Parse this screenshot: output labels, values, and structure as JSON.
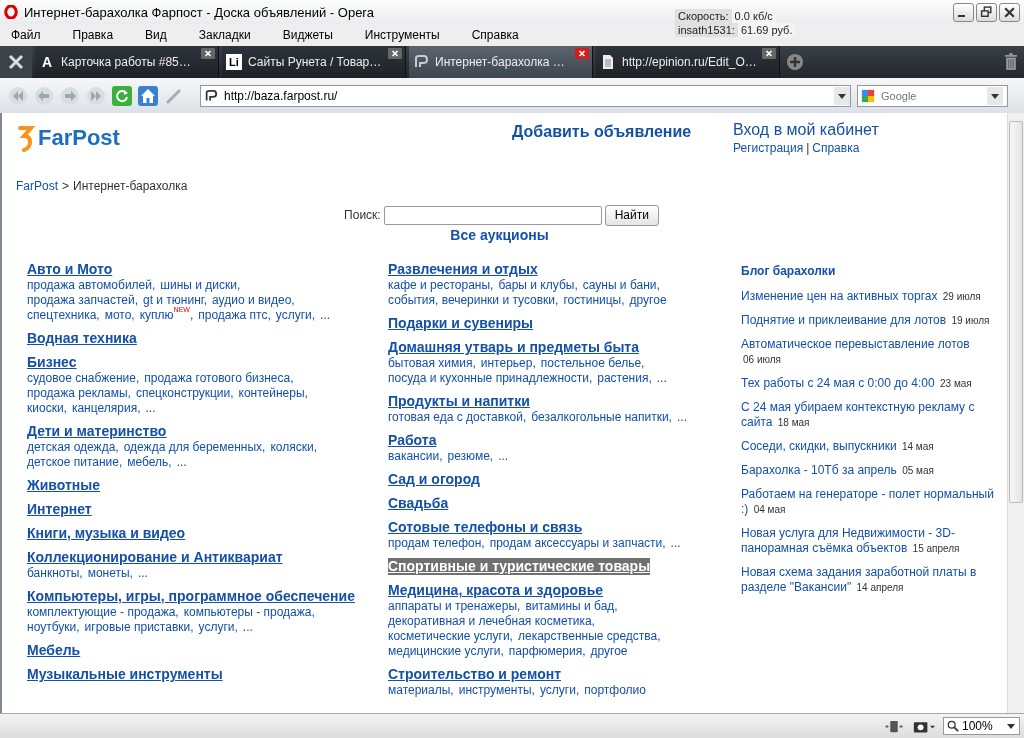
{
  "window": {
    "title": "Интернет-барахолка Фарпост - Доска объявлений - Opera"
  },
  "traffic": [
    {
      "label": "Скорость:",
      "value": "0.0 кб/с"
    },
    {
      "label": "insath1531:",
      "value": "61.69 руб."
    }
  ],
  "menu": [
    "Файл",
    "Правка",
    "Вид",
    "Закладки",
    "Виджеты",
    "Инструменты",
    "Справка"
  ],
  "tabs": [
    {
      "kind": "letter",
      "icon_text": "A",
      "label": "Карточка работы #85…",
      "selected": false
    },
    {
      "kind": "badge",
      "icon_text": "Li",
      "label": "Сайты Рунета / Товар…",
      "selected": false
    },
    {
      "kind": "site",
      "label": "Интернет-барахолка …",
      "selected": true
    },
    {
      "kind": "page",
      "label": "http://epinion.ru/Edit_O…",
      "selected": false
    }
  ],
  "address": {
    "value": "http://baza.farpost.ru/"
  },
  "search": {
    "placeholder": "Google"
  },
  "page": {
    "logo": "FarPost",
    "add_ad": "Добавить объявление",
    "login": "Вход в мой кабинет",
    "register": "Регистрация",
    "help": "Справка",
    "separator": "|",
    "breadcrumb_link": "FarPost",
    "breadcrumb_separator": ">",
    "breadcrumb_current": "Интернет-барахолка",
    "search_label": "Поиск:",
    "search_button": "Найти",
    "all_auctions": "Все аукционы"
  },
  "columns": [
    [
      {
        "title": "Авто и Мото",
        "highlighted": false,
        "subs": [
          "продажа автомобилей,",
          "шины и диски,",
          "продажа запчастей,",
          "gt и тюнинг,",
          "аудио и видео,",
          "спецтехника,",
          "мото,",
          "куплю$^{NEW}$,",
          "продажа птс,",
          "услуги,",
          "..."
        ]
      },
      {
        "title": "Водная техника",
        "highlighted": false
      },
      {
        "title": "Бизнес",
        "highlighted": false,
        "subs": [
          "судовое снабжение,",
          "продажа готового бизнеса,",
          "продажа рекламы,",
          "спецконструкции,",
          "контейнеры,",
          "киоски,",
          "канцелярия,",
          "..."
        ]
      },
      {
        "title": "Дети и материнство",
        "highlighted": false,
        "subs": [
          "детская одежда,",
          "одежда для беременных,",
          "коляски,",
          "детское питание,",
          "мебель,",
          "..."
        ]
      },
      {
        "title": "Животные",
        "highlighted": false
      },
      {
        "title": "Интернет",
        "highlighted": false
      },
      {
        "title": "Книги, музыка и видео",
        "highlighted": false
      },
      {
        "title": "Коллекционирование и Антиквариат",
        "highlighted": false,
        "subs": [
          "банкноты,",
          "монеты,",
          "..."
        ]
      },
      {
        "title": "Компьютеры, игры, программное обеспечение",
        "highlighted": false,
        "subs": [
          "комплектующие - продажа,",
          "компьютеры - продажа,",
          "ноутбуки,",
          "игровые приставки,",
          "услуги,",
          "..."
        ]
      },
      {
        "title": "Мебель",
        "highlighted": false
      },
      {
        "title": "Музыкальные инструменты",
        "highlighted": false
      }
    ],
    [
      {
        "title": "Развлечения и отдых",
        "highlighted": false,
        "subs": [
          "кафе и рестораны,",
          "бары и клубы,",
          "сауны и бани,",
          "события, вечеринки и тусовки,",
          "гостиницы,",
          "другое"
        ]
      },
      {
        "title": "Подарки и сувениры",
        "highlighted": false
      },
      {
        "title": "Домашняя утварь и предметы быта",
        "highlighted": false,
        "subs": [
          "бытовая химия,",
          "интерьер,",
          "постельное белье,",
          "посуда и кухонные принадлежности,",
          "растения,",
          "..."
        ]
      },
      {
        "title": "Продукты и напитки",
        "highlighted": false,
        "subs": [
          "готовая еда с доставкой,",
          "безалкогольные напитки,",
          "..."
        ]
      },
      {
        "title": "Работа",
        "highlighted": false,
        "subs": [
          "вакансии,",
          "резюме,",
          "..."
        ]
      },
      {
        "title": "Сад и огород",
        "highlighted": false
      },
      {
        "title": "Свадьба",
        "highlighted": false
      },
      {
        "title": "Сотовые телефоны и связь",
        "highlighted": false,
        "subs": [
          "продам телефон,",
          "продам аксессуары и запчасти,",
          "..."
        ]
      },
      {
        "title": "Спортивные и туристические товары",
        "highlighted": true
      },
      {
        "title": "Медицина, красота и здоровье",
        "highlighted": false,
        "subs": [
          "аппараты и тренажеры,",
          "витамины и бад,",
          "декоративная и лечебная косметика,",
          "косметические услуги,",
          "лекарственные средства,",
          "медицинские услуги,",
          "парфюмерия,",
          "другое"
        ]
      },
      {
        "title": "Строительство и ремонт",
        "highlighted": false,
        "subs": [
          "материалы,",
          "инструменты,",
          "услуги,",
          "портфолио"
        ]
      }
    ]
  ],
  "blog": {
    "title": "Блог барахолки",
    "posts": [
      {
        "title": "Изменение цен на активных торгах",
        "date": "29 июля"
      },
      {
        "title": "Поднятие и приклеивание для лотов",
        "date": "19 июля"
      },
      {
        "title": "Автоматическое перевыставление лотов",
        "date": "06 июля"
      },
      {
        "title": "Тех работы с 24 мая с 0:00 до 4:00",
        "date": "23 мая"
      },
      {
        "title": "С 24 мая убираем контекстную рекламу с сайта",
        "date": "18 мая"
      },
      {
        "title": "Соседи, скидки, выпускники",
        "date": "14 мая"
      },
      {
        "title": "Барахолка - 10Тб за апрель",
        "date": "05 мая"
      },
      {
        "title": "Работаем на генераторе - полет нормальный :)",
        "date": "04 мая"
      },
      {
        "title": "Новая услуга для Недвижимости - 3D-панорамная съёмка объектов",
        "date": "15 апреля"
      },
      {
        "title": "Новая схема задания заработной платы в разделе \"Вакансии\"",
        "date": "14 апреля"
      }
    ]
  },
  "status_bar": {
    "zoom": "100%"
  }
}
